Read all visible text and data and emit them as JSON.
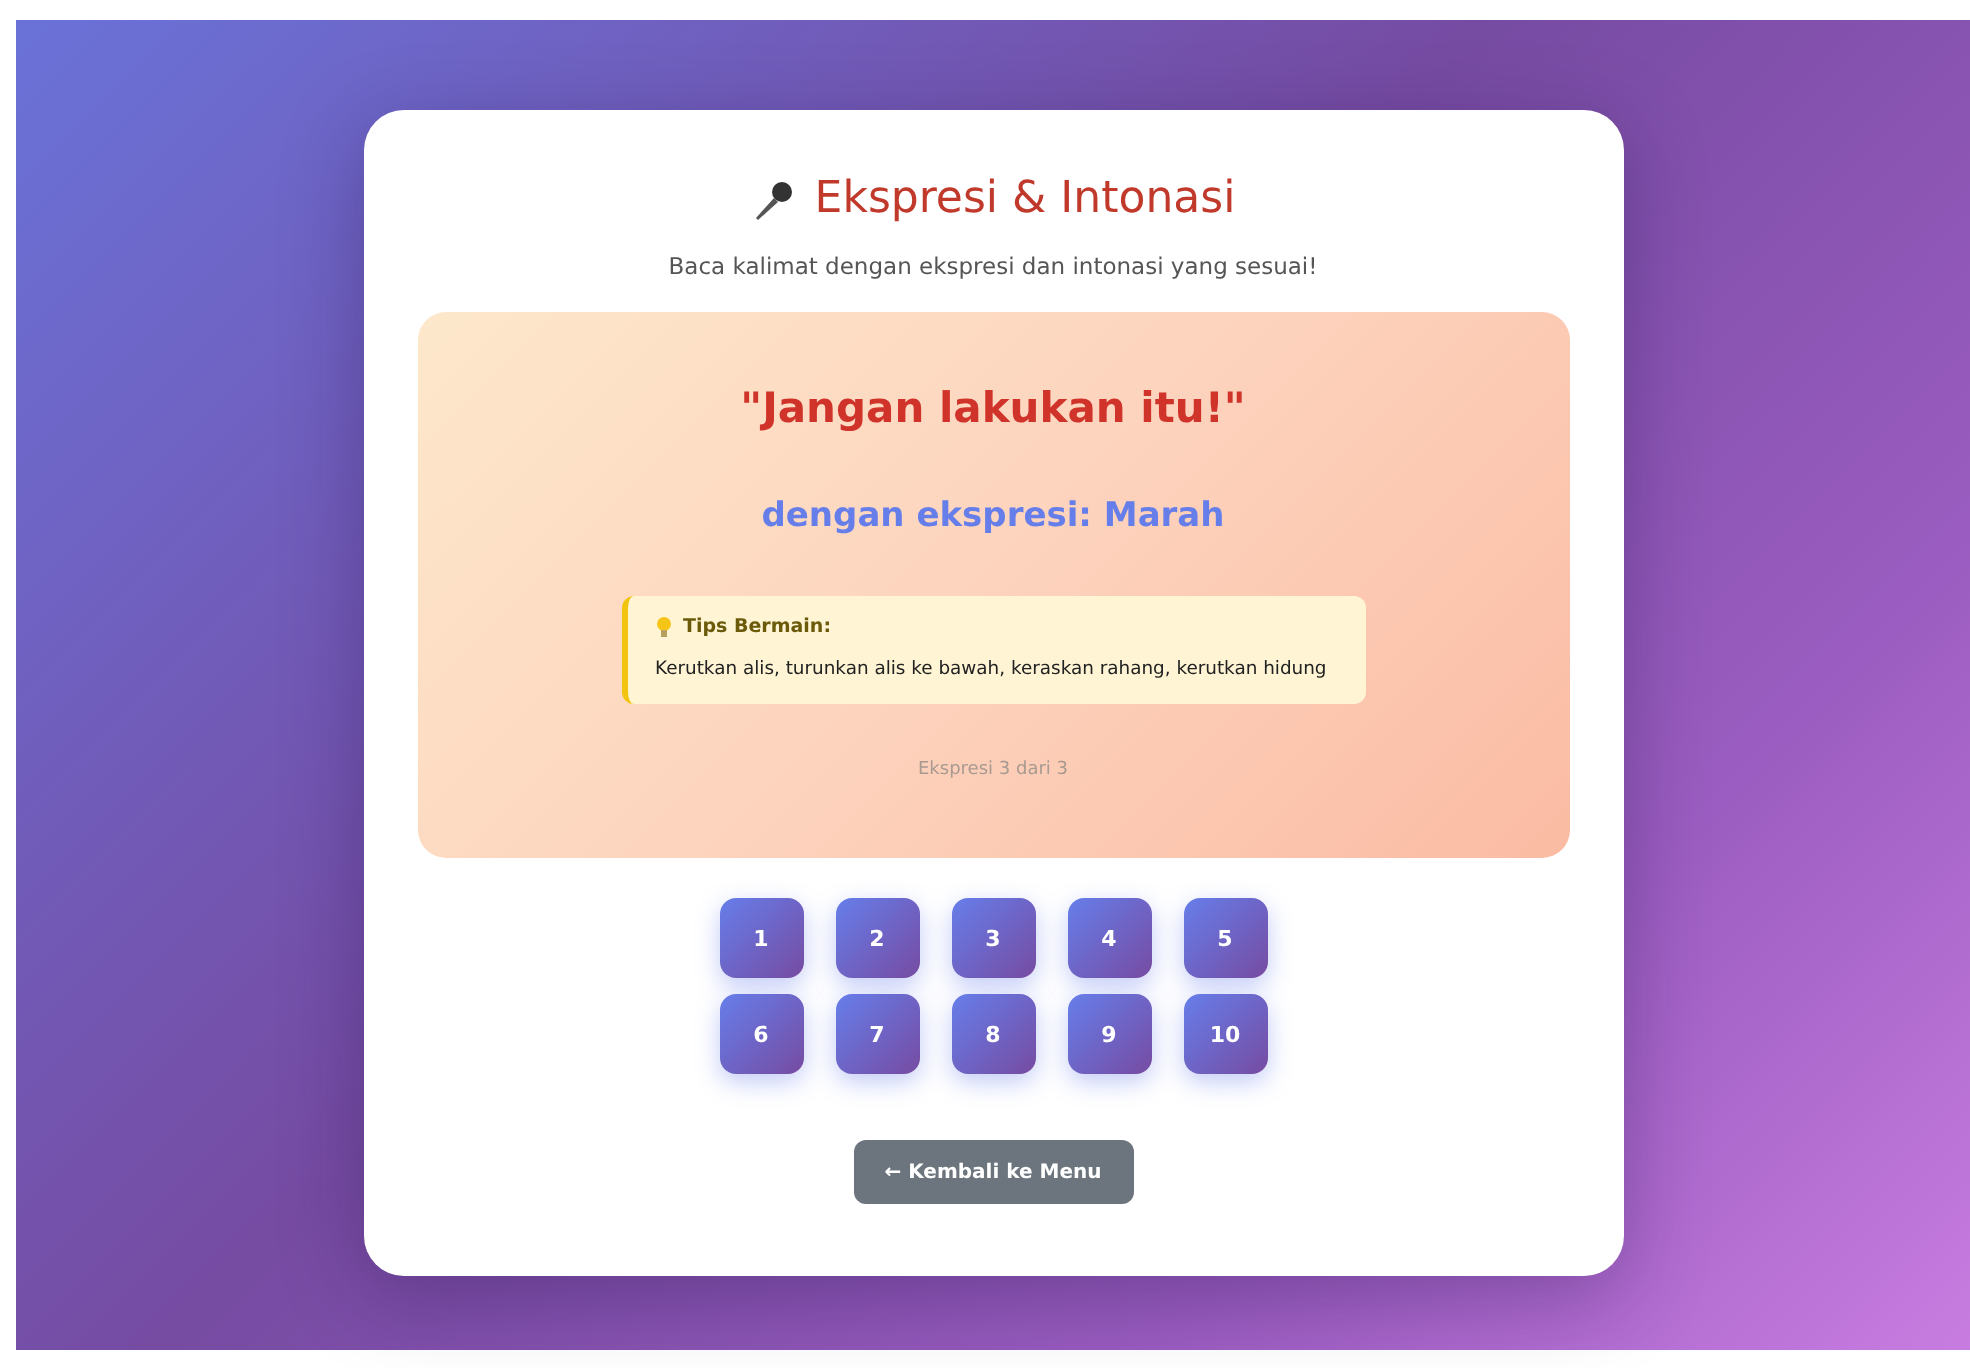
{
  "title": "Ekspresi & Intonasi",
  "subtitle": "Baca kalimat dengan ekspresi dan intonasi yang sesuai!",
  "sentence": "\"Jangan lakukan itu!\"",
  "expression": "dengan ekspresi: Marah",
  "tips": {
    "heading": "Tips Bermain:",
    "text": "Kerutkan alis, turunkan alis ke bawah, keraskan rahang, kerutkan hidung"
  },
  "counter": "Ekspresi 3 dari 3",
  "numbers": [
    "1",
    "2",
    "3",
    "4",
    "5",
    "6",
    "7",
    "8",
    "9",
    "10"
  ],
  "back_button": "← Kembali ke Menu"
}
